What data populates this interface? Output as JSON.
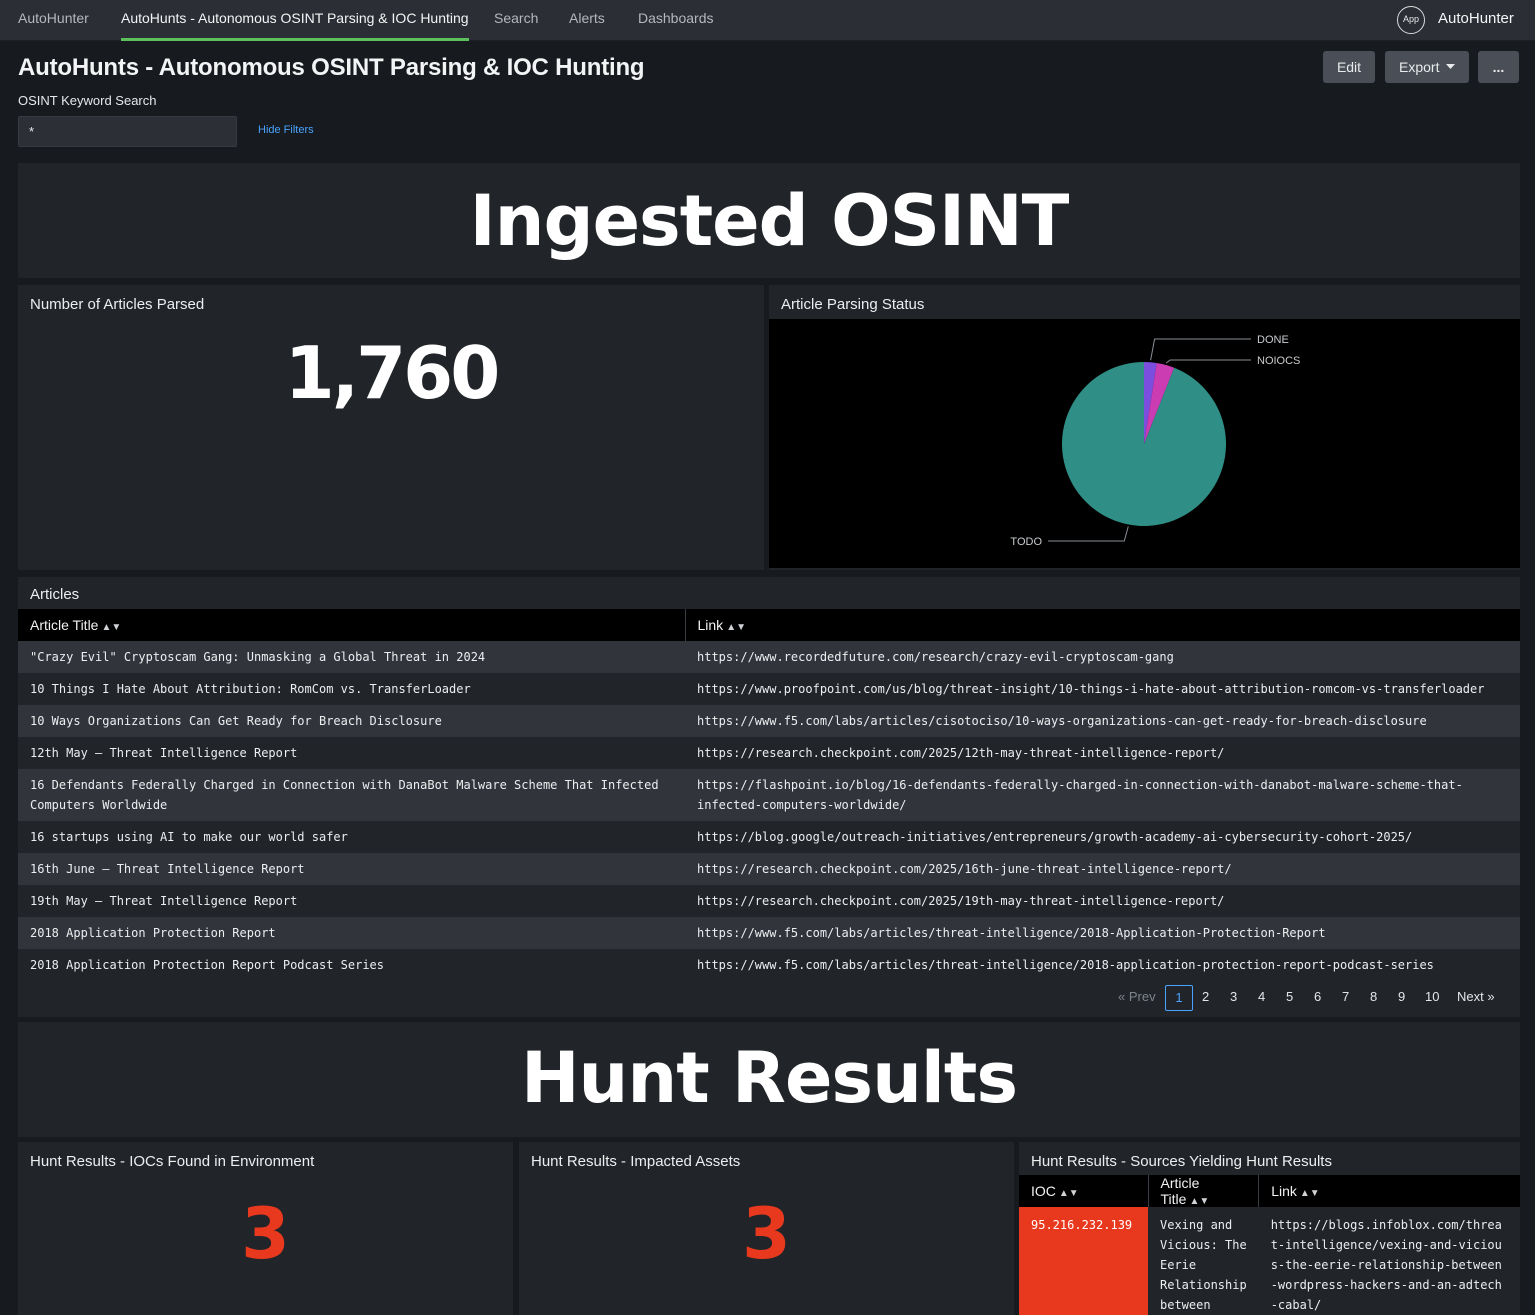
{
  "nav": {
    "items": [
      {
        "label": "AutoHunter"
      },
      {
        "label": "AutoHunts - Autonomous OSINT Parsing & IOC Hunting"
      },
      {
        "label": "Search"
      },
      {
        "label": "Alerts"
      },
      {
        "label": "Dashboards"
      }
    ],
    "app_badge": "App",
    "app_name": "AutoHunter"
  },
  "header": {
    "title": "AutoHunts - Autonomous OSINT Parsing & IOC Hunting",
    "edit_label": "Edit",
    "export_label": "Export",
    "more_label": "..."
  },
  "filter": {
    "label": "OSINT Keyword Search",
    "value": "*",
    "hide_filters": "Hide Filters"
  },
  "sections": {
    "ingested": "Ingested OSINT",
    "hunt": "Hunt Results"
  },
  "articles_parsed": {
    "title": "Number of Articles Parsed",
    "value": "1,760"
  },
  "parsing_status": {
    "title": "Article Parsing Status"
  },
  "chart_data": {
    "type": "pie",
    "title": "Article Parsing Status",
    "categories": [
      "DONE",
      "NOIOCS",
      "TODO"
    ],
    "values": [
      2.5,
      3.5,
      94
    ],
    "colors": [
      "#7b4ee0",
      "#cb3cb3",
      "#2f8f86"
    ]
  },
  "articles": {
    "title": "Articles",
    "columns": [
      "Article Title",
      "Link"
    ],
    "rows": [
      {
        "title": "\"Crazy Evil\" Cryptoscam Gang: Unmasking a Global Threat in 2024",
        "link": "https://www.recordedfuture.com/research/crazy-evil-cryptoscam-gang"
      },
      {
        "title": "10 Things I Hate About Attribution: RomCom vs. TransferLoader",
        "link": "https://www.proofpoint.com/us/blog/threat-insight/10-things-i-hate-about-attribution-romcom-vs-transferloader"
      },
      {
        "title": "10 Ways Organizations Can Get Ready for Breach Disclosure",
        "link": "https://www.f5.com/labs/articles/cisotociso/10-ways-organizations-can-get-ready-for-breach-disclosure"
      },
      {
        "title": "12th May – Threat Intelligence Report",
        "link": "https://research.checkpoint.com/2025/12th-may-threat-intelligence-report/"
      },
      {
        "title": "16 Defendants Federally Charged in Connection with DanaBot Malware Scheme That Infected Computers Worldwide",
        "link": "https://flashpoint.io/blog/16-defendants-federally-charged-in-connection-with-danabot-malware-scheme-that-infected-computers-worldwide/"
      },
      {
        "title": "16 startups using AI to make our world safer",
        "link": "https://blog.google/outreach-initiatives/entrepreneurs/growth-academy-ai-cybersecurity-cohort-2025/"
      },
      {
        "title": "16th June – Threat Intelligence Report",
        "link": "https://research.checkpoint.com/2025/16th-june-threat-intelligence-report/"
      },
      {
        "title": "19th May – Threat Intelligence Report",
        "link": "https://research.checkpoint.com/2025/19th-may-threat-intelligence-report/"
      },
      {
        "title": "2018 Application Protection Report",
        "link": "https://www.f5.com/labs/articles/threat-intelligence/2018-Application-Protection-Report"
      },
      {
        "title": "2018 Application Protection Report Podcast Series",
        "link": "https://www.f5.com/labs/articles/threat-intelligence/2018-application-protection-report-podcast-series"
      }
    ]
  },
  "pagination": {
    "prev": "« Prev",
    "pages": [
      "1",
      "2",
      "3",
      "4",
      "5",
      "6",
      "7",
      "8",
      "9",
      "10"
    ],
    "current": "1",
    "next": "Next »"
  },
  "hunt_iocs": {
    "title": "Hunt Results - IOCs Found in Environment",
    "value": "3"
  },
  "hunt_assets": {
    "title": "Hunt Results - Impacted Assets",
    "value": "3"
  },
  "hunt_sources": {
    "title": "Hunt Results - Sources Yielding Hunt Results",
    "columns": [
      "IOC",
      "Article Title",
      "Link"
    ],
    "rows": [
      {
        "ioc": "95.216.232.139",
        "title": "Vexing and Vicious: The Eerie Relationship between",
        "link": "https://blogs.infoblox.com/threat-intelligence/vexing-and-vicious-the-eerie-relationship-between-wordpress-hackers-and-an-adtech-cabal/"
      }
    ]
  },
  "colors": {
    "accent_green": "#5cc05c",
    "alert_red": "#e8391e",
    "link_blue": "#4aa3ff"
  }
}
